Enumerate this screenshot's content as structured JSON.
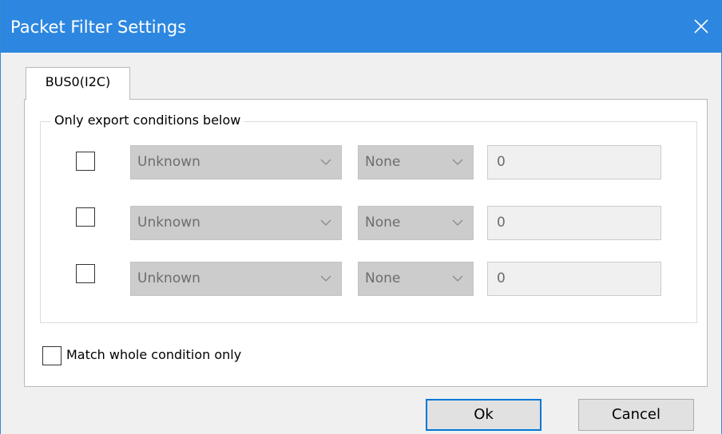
{
  "window": {
    "title": "Packet Filter Settings",
    "accent_color": "#2d87e0",
    "close_icon": "close-icon"
  },
  "tabs": [
    {
      "label": "BUS0(I2C)",
      "selected": true
    }
  ],
  "group": {
    "title": "Only export conditions below",
    "conditions": [
      {
        "checked": false,
        "field": "Unknown",
        "operator": "None",
        "value": "0"
      },
      {
        "checked": false,
        "field": "Unknown",
        "operator": "None",
        "value": "0"
      },
      {
        "checked": false,
        "field": "Unknown",
        "operator": "None",
        "value": "0"
      }
    ]
  },
  "match_whole": {
    "label": "Match whole condition only",
    "checked": false
  },
  "buttons": {
    "ok_label": "Ok",
    "cancel_label": "Cancel"
  }
}
